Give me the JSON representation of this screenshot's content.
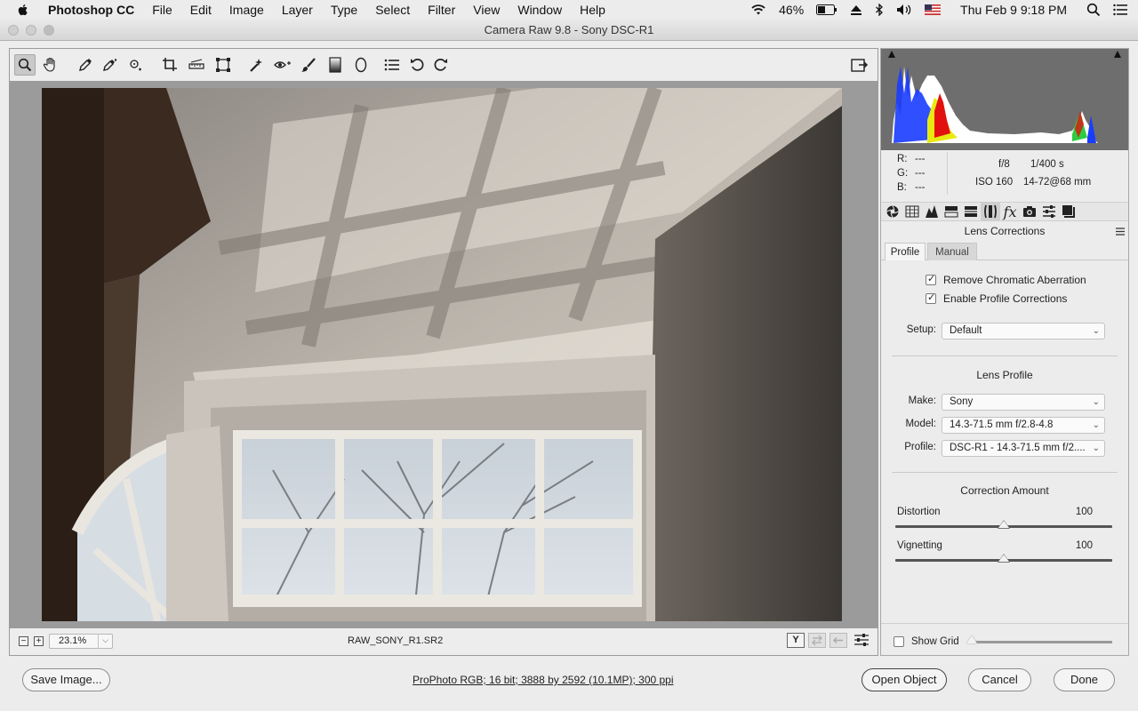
{
  "menubar": {
    "app_name": "Photoshop CC",
    "items": [
      "File",
      "Edit",
      "Image",
      "Layer",
      "Type",
      "Select",
      "Filter",
      "View",
      "Window",
      "Help"
    ],
    "battery": "46%",
    "clock": "Thu Feb 9  9:18 PM"
  },
  "window": {
    "title": "Camera Raw 9.8  -  Sony DSC-R1"
  },
  "status": {
    "zoom": "23.1%",
    "filename": "RAW_SONY_R1.SR2"
  },
  "info": {
    "r_label": "R:",
    "g_label": "G:",
    "b_label": "B:",
    "r_value": "---",
    "g_value": "---",
    "b_value": "---",
    "aperture": "f/8",
    "shutter": "1/400 s",
    "iso": "ISO 160",
    "focal": "14-72@68 mm"
  },
  "panel": {
    "title": "Lens Corrections",
    "tabs": [
      "Profile",
      "Manual"
    ],
    "remove_ca_label": "Remove Chromatic Aberration",
    "enable_profile_label": "Enable Profile Corrections",
    "setup_label": "Setup:",
    "setup_value": "Default",
    "lens_profile_title": "Lens Profile",
    "make_label": "Make:",
    "make_value": "Sony",
    "model_label": "Model:",
    "model_value": "14.3-71.5 mm f/2.8-4.8",
    "profile_label": "Profile:",
    "profile_value": "DSC-R1 - 14.3-71.5 mm f/2....",
    "correction_title": "Correction Amount",
    "distortion_label": "Distortion",
    "distortion_value": "100",
    "vignetting_label": "Vignetting",
    "vignetting_value": "100",
    "show_grid_label": "Show Grid"
  },
  "controls": {
    "remove_ca_checked": true,
    "enable_profile_checked": true,
    "show_grid_checked": false,
    "distortion_fraction": 0.5,
    "vignetting_fraction": 0.5
  },
  "bottom": {
    "save_label": "Save Image...",
    "workflow_text": "ProPhoto RGB; 16 bit; 3888 by 2592 (10.1MP); 300 ppi",
    "open_label": "Open Object",
    "cancel_label": "Cancel",
    "done_label": "Done"
  },
  "colors": {
    "histogram_bg": "#6e6e6e",
    "panel_bg": "#ececec"
  }
}
